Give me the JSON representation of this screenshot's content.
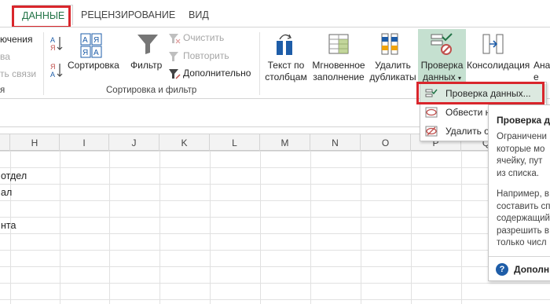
{
  "tabs": {
    "data": "ДАННЫЕ",
    "review": "РЕЦЕНЗИРОВАНИЕ",
    "view": "ВИД"
  },
  "ribbon": {
    "connections_partial": [
      "ючения",
      "ва",
      "ть связи"
    ],
    "group_connections_partial": "я",
    "sort_label": "Сортировка",
    "filter_label": "Фильтр",
    "clear_label": "Очистить",
    "reapply_label": "Повторить",
    "advanced_label": "Дополнительно",
    "sort_filter_group": "Сортировка и фильтр",
    "text_to_columns": [
      "Текст по",
      "столбцам"
    ],
    "flash_fill": [
      "Мгновенное",
      "заполнение"
    ],
    "remove_duplicates": [
      "Удалить",
      "дубликаты"
    ],
    "data_validation": [
      "Проверка",
      "данных"
    ],
    "consolidate": "Консолидация",
    "analysis_partial": [
      "Ана",
      "е"
    ]
  },
  "dropdown": {
    "items": [
      "Проверка данных...",
      "Обвести н",
      "Удалить о"
    ]
  },
  "tooltip": {
    "title": "Проверка д",
    "para1": [
      "Ограничени",
      "которые мо",
      "ячейку, пут",
      "из списка."
    ],
    "para2": [
      "Например, в",
      "составить сп",
      "содержащий",
      "разрешить в",
      "только числ"
    ],
    "more": "Дополн",
    "help_icon": "?"
  },
  "grid": {
    "columns": [
      "H",
      "I",
      "J",
      "K",
      "L",
      "M",
      "N",
      "O",
      "P",
      "Q"
    ],
    "cells": [
      "отдел",
      "ал",
      "нта"
    ]
  },
  "colors": {
    "accent": "#217346",
    "highlight_red": "#d9262c",
    "dv_button_bg": "#c5e0d0"
  }
}
